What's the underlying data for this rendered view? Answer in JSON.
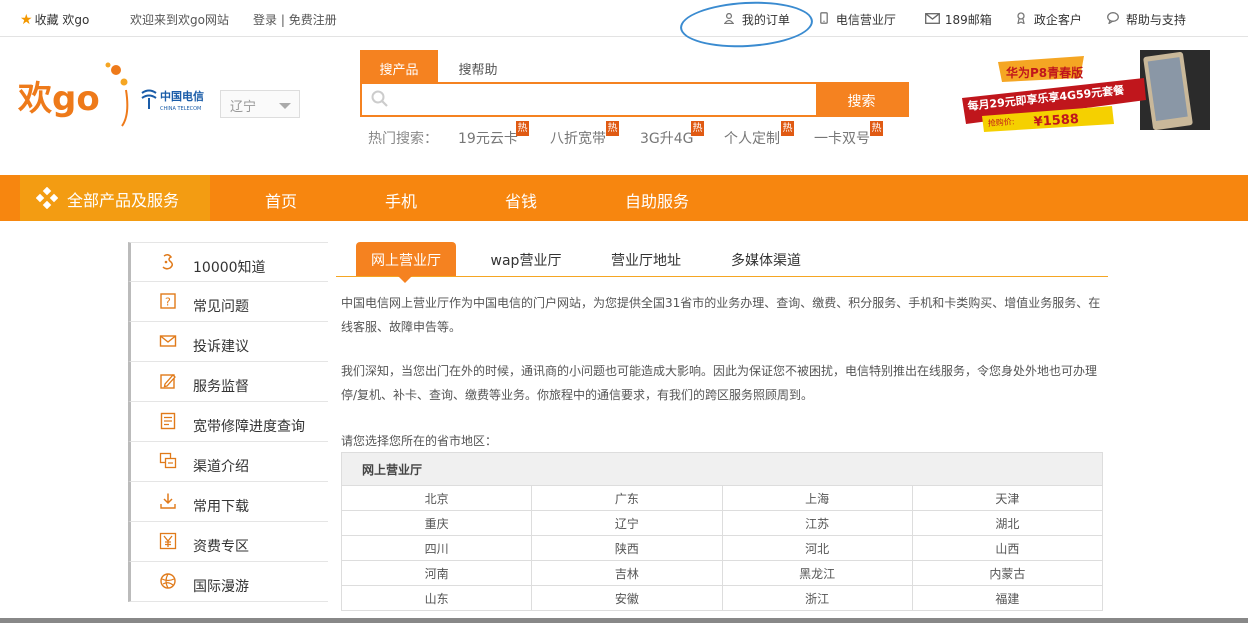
{
  "topbar": {
    "favorite": "收藏",
    "favorite_brand": "欢go",
    "welcome": "欢迎来到欢go网站",
    "login": "登录",
    "register": "免费注册",
    "separator": "|",
    "my_orders": "我的订单",
    "telecom_hall": "电信营业厅",
    "mail": "189邮箱",
    "gov_enterprise": "政企客户",
    "help": "帮助与支持"
  },
  "header": {
    "logo_text": "欢go",
    "carrier_cn": "中国电信",
    "carrier_en": "CHINA TELECOM",
    "region": "辽宁",
    "search_tabs": [
      "搜产品",
      "搜帮助"
    ],
    "search_placeholder": "",
    "search_button": "搜索",
    "hot_label": "热门搜索：",
    "hot_keywords": [
      "19元云卡",
      "八折宽带",
      "3G升4G",
      "个人定制",
      "一卡双号"
    ],
    "hot_tag": "热"
  },
  "banner": {
    "line1": "华为P8青春版",
    "line2": "每月29元即享乐享4G59元套餐",
    "price_label": "抢购价:",
    "price": "¥1588"
  },
  "nav": {
    "all": "全部产品及服务",
    "items": [
      "首页",
      "手机",
      "省钱",
      "自助服务"
    ]
  },
  "sidebar": {
    "items": [
      {
        "label": "10000知道",
        "icon": "knowledge-icon"
      },
      {
        "label": "常见问题",
        "icon": "question-icon"
      },
      {
        "label": "投诉建议",
        "icon": "mail-icon"
      },
      {
        "label": "服务监督",
        "icon": "edit-icon"
      },
      {
        "label": "宽带修障进度查询",
        "icon": "document-icon"
      },
      {
        "label": "渠道介绍",
        "icon": "channel-icon"
      },
      {
        "label": "常用下载",
        "icon": "download-icon"
      },
      {
        "label": "资费专区",
        "icon": "yen-icon"
      },
      {
        "label": "国际漫游",
        "icon": "globe-icon"
      }
    ]
  },
  "content": {
    "tabs": [
      "网上营业厅",
      "wap营业厅",
      "营业厅地址",
      "多媒体渠道"
    ],
    "para1": "中国电信网上营业厅作为中国电信的门户网站，为您提供全国31省市的业务办理、查询、缴费、积分服务、手机和卡类购买、增值业务服务、在线客服、故障申告等。",
    "para2": "我们深知，当您出门在外的时候，通讯商的小问题也可能造成大影响。因此为保证您不被困扰，电信特别推出在线服务，令您身处外地也可办理停/复机、补卡、查询、缴费等业务。你旅程中的通信要求，有我们的跨区服务照顾周到。",
    "prompt": "请您选择您所在的省市地区：",
    "table_title": "网上营业厅",
    "provinces": [
      [
        "北京",
        "广东",
        "上海",
        "天津"
      ],
      [
        "重庆",
        "辽宁",
        "江苏",
        "湖北"
      ],
      [
        "四川",
        "陕西",
        "河北",
        "山西"
      ],
      [
        "河南",
        "吉林",
        "黑龙江",
        "内蒙古"
      ],
      [
        "山东",
        "安徽",
        "浙江",
        "福建"
      ]
    ]
  }
}
